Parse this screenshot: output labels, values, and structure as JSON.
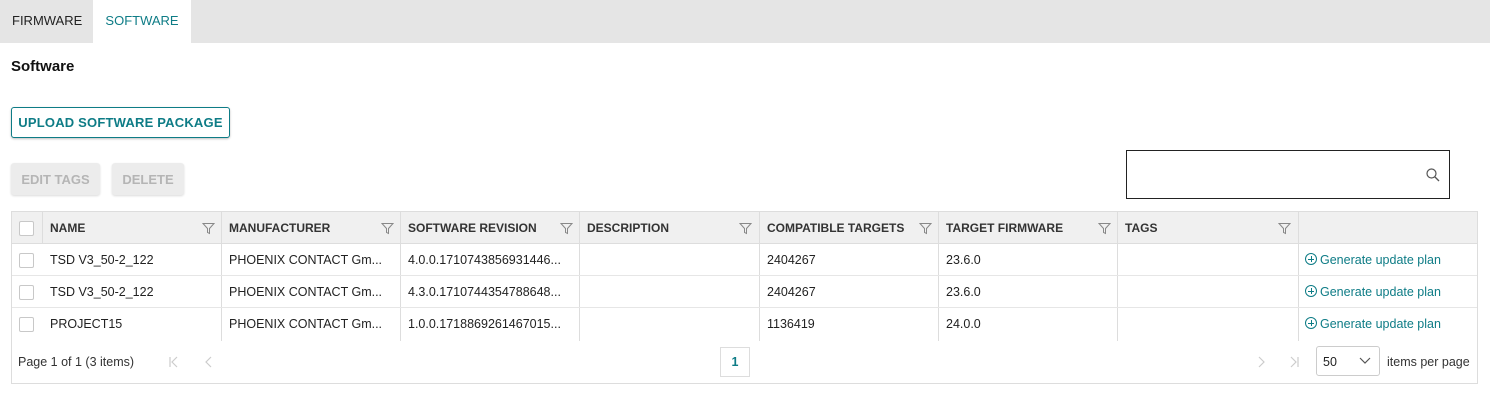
{
  "tabs": [
    {
      "label": "FIRMWARE"
    },
    {
      "label": "SOFTWARE"
    }
  ],
  "page_title": "Software",
  "buttons": {
    "upload": "UPLOAD SOFTWARE PACKAGE",
    "edit_tags": "EDIT TAGS",
    "delete": "DELETE"
  },
  "search": {
    "value": "",
    "placeholder": ""
  },
  "columns": [
    "NAME",
    "MANUFACTURER",
    "SOFTWARE REVISION",
    "DESCRIPTION",
    "COMPATIBLE TARGETS",
    "TARGET FIRMWARE",
    "TAGS"
  ],
  "rows": [
    {
      "name": "TSD V3_50-2_122",
      "manufacturer": "PHOENIX CONTACT Gm...",
      "revision": "4.0.0.1710743856931446...",
      "description": "",
      "targets": "2404267",
      "firmware": "23.6.0",
      "tags": "",
      "action": "Generate update plan"
    },
    {
      "name": "TSD V3_50-2_122",
      "manufacturer": "PHOENIX CONTACT Gm...",
      "revision": "4.3.0.1710744354788648...",
      "description": "",
      "targets": "2404267",
      "firmware": "23.6.0",
      "tags": "",
      "action": "Generate update plan"
    },
    {
      "name": "PROJECT15",
      "manufacturer": "PHOENIX CONTACT Gm...",
      "revision": "1.0.0.1718869261467015...",
      "description": "",
      "targets": "1136419",
      "firmware": "24.0.0",
      "tags": "",
      "action": "Generate update plan"
    }
  ],
  "pager": {
    "info": "Page 1 of 1 (3 items)",
    "current_page": "1",
    "page_size": "50",
    "page_size_label": "items per page"
  },
  "colors": {
    "accent": "#0e7c86"
  }
}
